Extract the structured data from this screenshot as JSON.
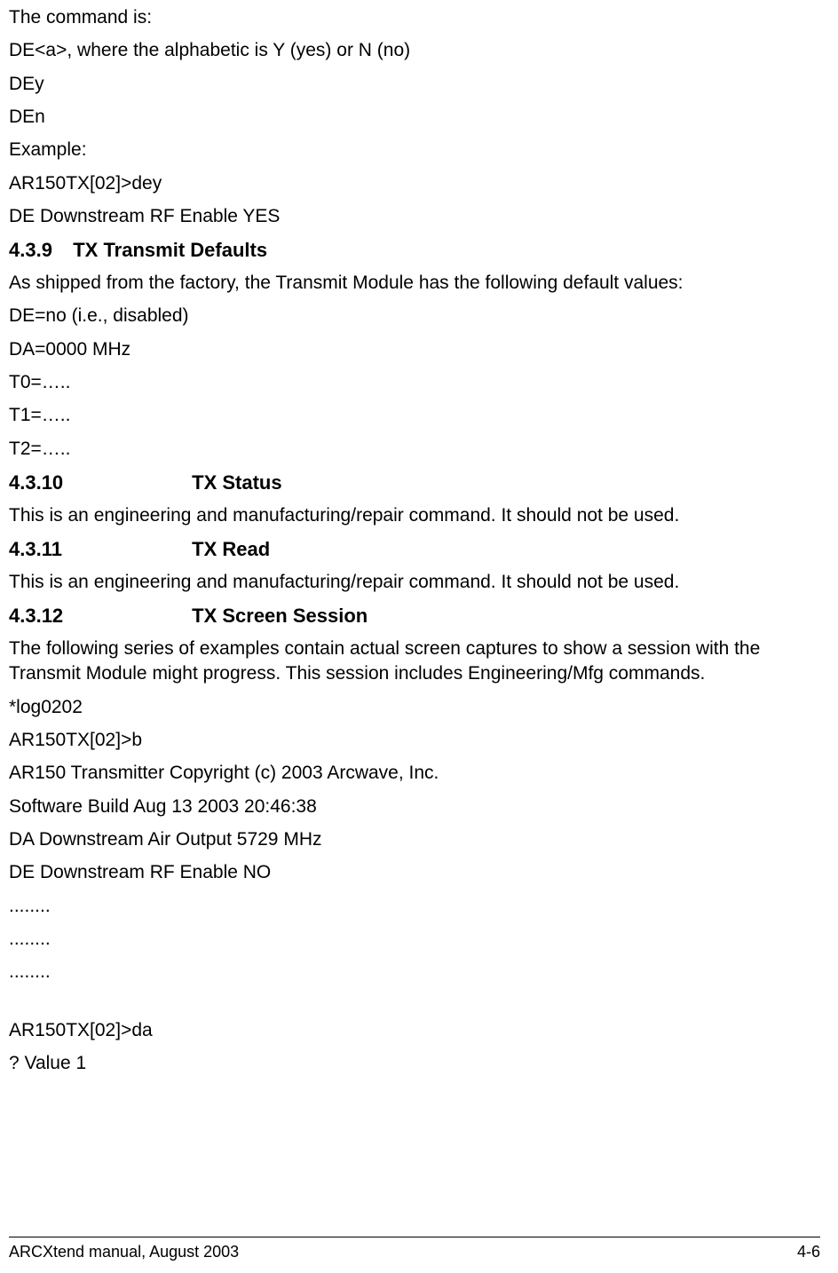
{
  "body": {
    "p1": "The command is:",
    "p2": "DE<a>, where the alphabetic is Y (yes) or N (no)",
    "p3": "DEy",
    "p4": "DEn",
    "p5": "Example:",
    "p6": "AR150TX[02]>dey",
    "p7": "DE   Downstream RF  Enable  YES"
  },
  "sec439": {
    "num": "4.3.9",
    "title": "TX Transmit Defaults",
    "p1": "As shipped from the factory, the Transmit Module has the following default values:",
    "p2": "DE=no (i.e., disabled)",
    "p3": "DA=0000 MHz",
    "p4": "T0=…..",
    "p5": "T1=…..",
    "p6": "T2=….."
  },
  "sec4310": {
    "num": "4.3.10",
    "title": "TX Status",
    "p1": "This is an engineering and manufacturing/repair command.  It should not be used."
  },
  "sec4311": {
    "num": "4.3.11",
    "title": "TX Read",
    "p1": "This is an engineering and manufacturing/repair command.  It should not be used."
  },
  "sec4312": {
    "num": "4.3.12",
    "title": "TX Screen Session",
    "p1": "The following series of examples contain actual screen captures to show a session with the Transmit Module might progress.  This session includes Engineering/Mfg commands.",
    "p2": "*log0202",
    "p3": "AR150TX[02]>b",
    "p4": "AR150 Transmitter Copyright (c) 2003 Arcwave, Inc.",
    "p5": "Software Build    Aug 13 2003 20:46:38",
    "p6": "DA   Downstream Air Output  5729 MHz",
    "p7": "DE   Downstream RF  Enable  NO",
    "p8": "........",
    "p9": "........",
    "p10": "........",
    "p11": "AR150TX[02]>da",
    "p12": "? Value 1"
  },
  "footer": {
    "left": "ARCXtend manual, August 2003",
    "right": "4-6"
  }
}
